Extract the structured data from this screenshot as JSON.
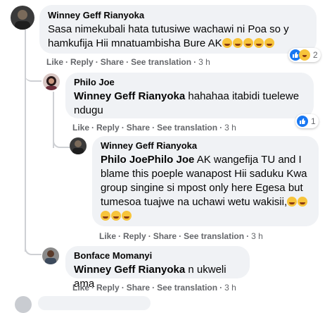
{
  "comments": [
    {
      "author": "Winney Geff Rianyoka",
      "text_line1": "Sasa nimekubali hata tutusiwe wachawi ni Poa so y",
      "text_line2": "hamkufija Hii mnatuambisha Bure AK",
      "reaction_count": "2",
      "actions": {
        "like": "Like",
        "reply": "Reply",
        "share": "Share",
        "translation": "See translation",
        "time": "3 h"
      }
    },
    {
      "author": "Philo Joe",
      "mention": "Winney Geff Rianyoka",
      "text_line1": "hahahaa itabidi tuelewe",
      "text_line2": "ndugu",
      "reaction_count": "1",
      "actions": {
        "like": "Like",
        "reply": "Reply",
        "share": "Share",
        "translation": "See translation",
        "time": "3 h"
      }
    },
    {
      "author": "Winney Geff Rianyoka",
      "mention": "Philo JoePhilo Joe",
      "text_line1": "AK wangefija TU and I",
      "text_line2": "blame this poeple wanapost Hii saduku Kwa",
      "text_line3": "group singine si mpost only here Egesa but",
      "text_line4": "tumesoa tuajwe na uchawi wetu wakisii,",
      "actions": {
        "like": "Like",
        "reply": "Reply",
        "share": "Share",
        "translation": "See translation",
        "time": "3 h"
      }
    },
    {
      "author": "Bonface Momanyi",
      "mention": "Winney Geff Rianyoka",
      "text": "n ukweli ama",
      "actions": {
        "like": "Like",
        "reply": "Reply",
        "share": "Share",
        "translation": "See translation",
        "time": "3 h"
      }
    }
  ],
  "colors": {
    "bubble": "#f0f2f5",
    "like_blue": "#1877f2",
    "haha_yellow": "#f7c43b",
    "meta_gray": "#65676b"
  },
  "icons": {
    "laugh_emoji": "rolling-on-floor-laughing-emoji",
    "like_reaction": "thumbs-up-icon",
    "haha_reaction": "haha-face-icon"
  }
}
